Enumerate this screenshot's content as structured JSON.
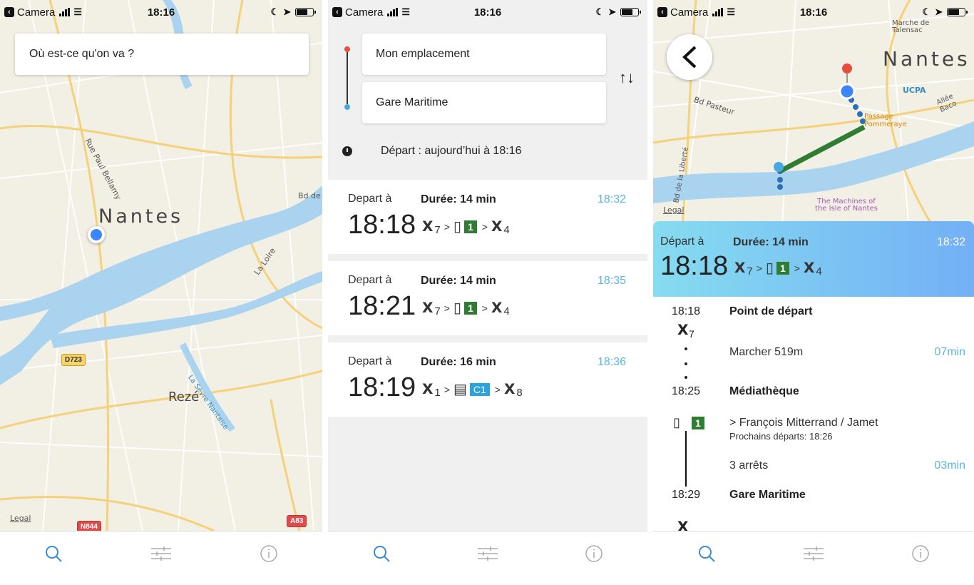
{
  "status": {
    "app": "Camera",
    "time": "18:16"
  },
  "panel1": {
    "search_placeholder": "Où est-ce qu'on va ?",
    "map_labels": {
      "city": "Nantes",
      "reze": "Rezé",
      "street": "Rue Paul Bellamy",
      "river": "La Loire",
      "sevre": "La Sèvre Nantaise",
      "bd": "Bd de",
      "d723": "D723",
      "n844": "N844",
      "a83": "A83",
      "legal": "Legal"
    }
  },
  "panel2": {
    "from": "Mon emplacement",
    "to": "Gare Maritime",
    "depart_text": "Départ : aujourd’hui à 18:16",
    "routes": [
      {
        "label": "Depart à",
        "duration": "Durée: 14 min",
        "arrival": "18:32",
        "time": "18:18",
        "walk1": "7",
        "line": "1",
        "walk2": "4",
        "mode": "tram"
      },
      {
        "label": "Depart à",
        "duration": "Durée: 14 min",
        "arrival": "18:35",
        "time": "18:21",
        "walk1": "7",
        "line": "1",
        "walk2": "4",
        "mode": "tram"
      },
      {
        "label": "Depart à",
        "duration": "Durée: 16 min",
        "arrival": "18:36",
        "time": "18:19",
        "walk1": "1",
        "line": "C1",
        "walk2": "8",
        "mode": "bus"
      }
    ]
  },
  "panel3": {
    "map_labels": {
      "city": "Nantes",
      "marche": "Marche de Talensac",
      "ucpa": "UCPA",
      "allee": "Allée Baco",
      "bdpasteur": "Bd Pasteur",
      "passage": "Passage Pommeraye",
      "liberte": "Bd de la Liberté",
      "machines": "The Machines of the Isle of Nantes",
      "legal": "Legal"
    },
    "header": {
      "label": "Départ à",
      "duration": "Durée: 14 min",
      "arrival": "18:32",
      "time": "18:18",
      "walk1": "7",
      "line": "1",
      "walk2": "4"
    },
    "steps": {
      "t1": "18:18",
      "s1": "Point de départ",
      "walk_n": "7",
      "walk_text": "Marcher 519m",
      "walk_min": "07min",
      "t2": "18:25",
      "s2": "Médiathèque",
      "line": "1",
      "direction": "> François Mitterrand / Jamet",
      "next": "Prochains départs: 18:26",
      "stops": "3 arrêts",
      "stops_min": "03min",
      "t3": "18:29",
      "s3": "Gare Maritime"
    }
  },
  "colors": {
    "accent": "#5bb6e0",
    "tram": "#2e7d32",
    "bus": "#29a4dd",
    "river": "#a9d3ee"
  }
}
